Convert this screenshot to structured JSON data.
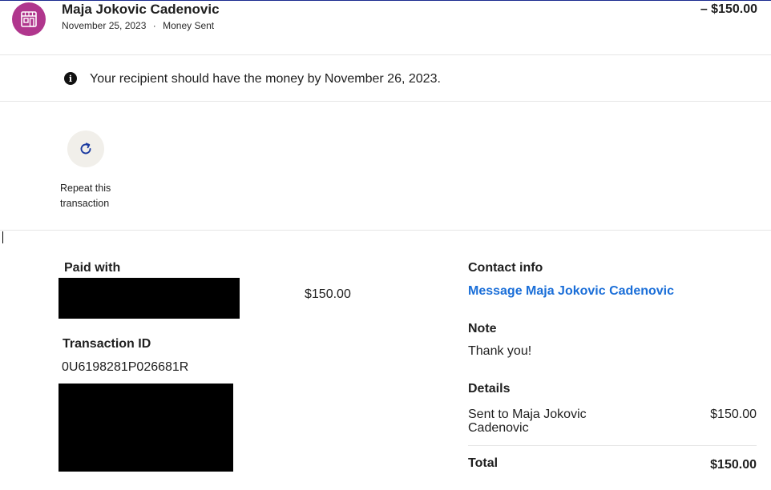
{
  "header": {
    "name": "Maja Jokovic Cadenovic",
    "date": "November 25, 2023",
    "separator": "·",
    "type": "Money Sent",
    "amount": "– $150.00",
    "avatar_icon": "storefront-icon",
    "avatar_color": "#b0368d"
  },
  "notice": {
    "icon": "info-icon",
    "text": "Your recipient should have the money by November 26, 2023."
  },
  "actions": {
    "repeat_icon": "refresh-icon",
    "repeat_label_line1": "Repeat this",
    "repeat_label_line2": "transaction"
  },
  "left": {
    "paid_with_label": "Paid with",
    "paid_amount": "$150.00",
    "transaction_id_label": "Transaction ID",
    "transaction_id": "0U6198281P026681R"
  },
  "right": {
    "contact_label": "Contact info",
    "message_link": "Message Maja Jokovic Cadenovic",
    "note_label": "Note",
    "note_text": "Thank you!",
    "details_label": "Details",
    "sent_to_line1": "Sent to Maja Jokovic",
    "sent_to_line2": "Cadenovic",
    "sent_amount": "$150.00",
    "total_label": "Total",
    "total_amount": "$150.00"
  },
  "colors": {
    "link": "#1a6ed8",
    "avatar": "#b0368d",
    "repeat_bg": "#f1efea"
  }
}
